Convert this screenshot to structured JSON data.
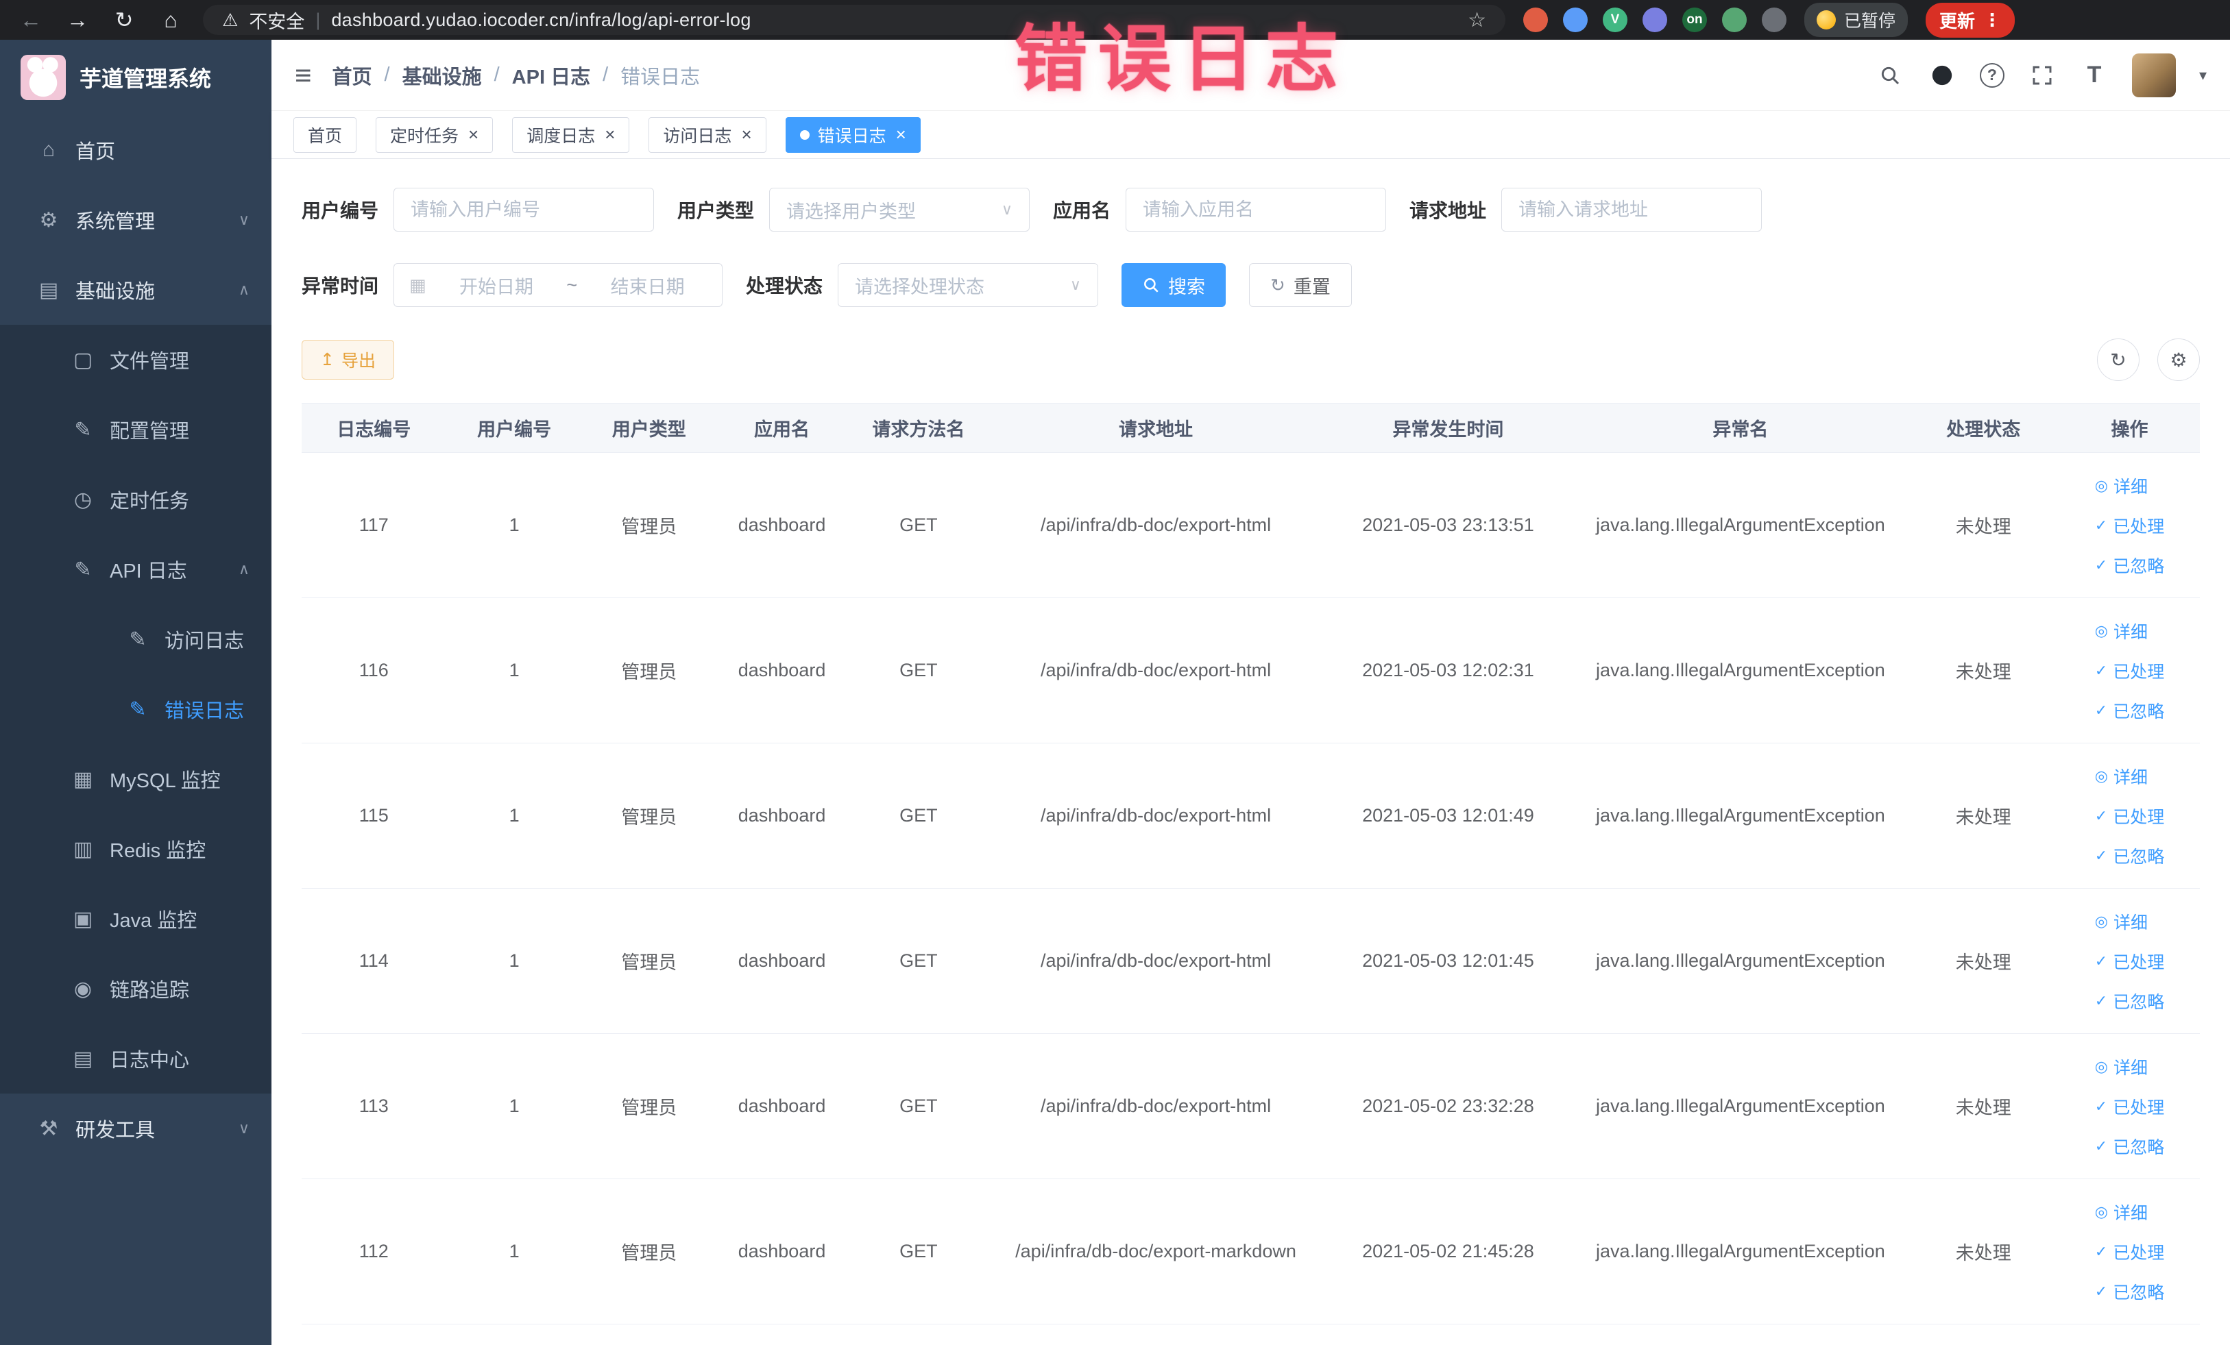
{
  "browser": {
    "security_label": "不安全",
    "url": "dashboard.yudao.iocoder.cn/infra/log/api-error-log",
    "paused_badge": "已暂停",
    "update_label": "更新",
    "extensions": [
      {
        "name": "extension-red-icon",
        "color": "#e05d44",
        "glyph": ""
      },
      {
        "name": "extension-blue-icon",
        "color": "#5b9cf8",
        "glyph": ""
      },
      {
        "name": "vue-devtools-icon",
        "color": "#42b883",
        "glyph": "V"
      },
      {
        "name": "extension-grid-icon",
        "color": "#7a7fe0",
        "glyph": ""
      },
      {
        "name": "extension-on-icon",
        "color": "#1e6b3c",
        "glyph": "on"
      },
      {
        "name": "extension-leaf-icon",
        "color": "#57a773",
        "glyph": ""
      },
      {
        "name": "extension-puzzle-icon",
        "color": "#6b6f76",
        "glyph": ""
      }
    ]
  },
  "annotation": {
    "text": "错误日志",
    "color": "#f2536f"
  },
  "sidebar": {
    "logo_title": "芋道管理系统",
    "menu": [
      {
        "label": "首页",
        "icon": "home-icon"
      },
      {
        "label": "系统管理",
        "icon": "gear-icon",
        "state": "collapsed"
      },
      {
        "label": "基础设施",
        "icon": "infra-icon",
        "state": "expanded",
        "children": [
          {
            "label": "文件管理",
            "icon": "file-icon"
          },
          {
            "label": "配置管理",
            "icon": "config-icon"
          },
          {
            "label": "定时任务",
            "icon": "timer-icon"
          },
          {
            "label": "API 日志",
            "icon": "api-log-icon",
            "state": "expanded",
            "children": [
              {
                "label": "访问日志",
                "icon": "access-log-icon"
              },
              {
                "label": "错误日志",
                "icon": "error-log-icon",
                "active": true
              }
            ]
          },
          {
            "label": "MySQL 监控",
            "icon": "mysql-icon"
          },
          {
            "label": "Redis 监控",
            "icon": "redis-icon"
          },
          {
            "label": "Java 监控",
            "icon": "java-icon"
          },
          {
            "label": "链路追踪",
            "icon": "trace-icon"
          },
          {
            "label": "日志中心",
            "icon": "log-center-icon"
          }
        ]
      },
      {
        "label": "研发工具",
        "icon": "tools-icon",
        "state": "collapsed"
      }
    ]
  },
  "header": {
    "breadcrumb": [
      "首页",
      "基础设施",
      "API 日志",
      "错误日志"
    ]
  },
  "tabs": [
    {
      "label": "首页",
      "closable": false,
      "active": false
    },
    {
      "label": "定时任务",
      "closable": true,
      "active": false
    },
    {
      "label": "调度日志",
      "closable": true,
      "active": false
    },
    {
      "label": "访问日志",
      "closable": true,
      "active": false
    },
    {
      "label": "错误日志",
      "closable": true,
      "active": true
    }
  ],
  "filter_rows": [
    [
      {
        "name": "user-id",
        "label": "用户编号",
        "type": "input",
        "placeholder": "请输入用户编号"
      },
      {
        "name": "user-type",
        "label": "用户类型",
        "type": "select",
        "placeholder": "请选择用户类型"
      },
      {
        "name": "app-name",
        "label": "应用名",
        "type": "input",
        "placeholder": "请输入应用名"
      },
      {
        "name": "request-url",
        "label": "请求地址",
        "type": "input",
        "placeholder": "请输入请求地址"
      }
    ],
    [
      {
        "name": "exception-time",
        "label": "异常时间",
        "type": "daterange",
        "start_placeholder": "开始日期",
        "separator": "~",
        "end_placeholder": "结束日期"
      },
      {
        "name": "process-status",
        "label": "处理状态",
        "type": "select",
        "placeholder": "请选择处理状态"
      }
    ]
  ],
  "filter_buttons": {
    "search": "搜索",
    "reset": "重置"
  },
  "toolbar": {
    "export_label": "导出"
  },
  "table": {
    "columns": [
      {
        "key": "id",
        "label": "日志编号"
      },
      {
        "key": "user_id",
        "label": "用户编号"
      },
      {
        "key": "user_type",
        "label": "用户类型"
      },
      {
        "key": "app",
        "label": "应用名"
      },
      {
        "key": "method",
        "label": "请求方法名"
      },
      {
        "key": "url",
        "label": "请求地址"
      },
      {
        "key": "time",
        "label": "异常发生时间"
      },
      {
        "key": "exception",
        "label": "异常名"
      },
      {
        "key": "status",
        "label": "处理状态"
      },
      {
        "key": "actions",
        "label": "操作"
      }
    ],
    "row_actions": [
      {
        "name": "detail-link",
        "label": "详细",
        "icon": "eye-icon"
      },
      {
        "name": "processed-link",
        "label": "已处理",
        "icon": "check-icon"
      },
      {
        "name": "ignored-link",
        "label": "已忽略",
        "icon": "check-icon"
      }
    ],
    "rows": [
      {
        "id": "117",
        "user_id": "1",
        "user_type": "管理员",
        "app": "dashboard",
        "method": "GET",
        "url": "/api/infra/db-doc/export-html",
        "time": "2021-05-03 23:13:51",
        "exception": "java.lang.IllegalArgumentException",
        "status": "未处理"
      },
      {
        "id": "116",
        "user_id": "1",
        "user_type": "管理员",
        "app": "dashboard",
        "method": "GET",
        "url": "/api/infra/db-doc/export-html",
        "time": "2021-05-03 12:02:31",
        "exception": "java.lang.IllegalArgumentException",
        "status": "未处理"
      },
      {
        "id": "115",
        "user_id": "1",
        "user_type": "管理员",
        "app": "dashboard",
        "method": "GET",
        "url": "/api/infra/db-doc/export-html",
        "time": "2021-05-03 12:01:49",
        "exception": "java.lang.IllegalArgumentException",
        "status": "未处理"
      },
      {
        "id": "114",
        "user_id": "1",
        "user_type": "管理员",
        "app": "dashboard",
        "method": "GET",
        "url": "/api/infra/db-doc/export-html",
        "time": "2021-05-03 12:01:45",
        "exception": "java.lang.IllegalArgumentException",
        "status": "未处理"
      },
      {
        "id": "113",
        "user_id": "1",
        "user_type": "管理员",
        "app": "dashboard",
        "method": "GET",
        "url": "/api/infra/db-doc/export-html",
        "time": "2021-05-02 23:32:28",
        "exception": "java.lang.IllegalArgumentException",
        "status": "未处理"
      },
      {
        "id": "112",
        "user_id": "1",
        "user_type": "管理员",
        "app": "dashboard",
        "method": "GET",
        "url": "/api/infra/db-doc/export-markdown",
        "time": "2021-05-02 21:45:28",
        "exception": "java.lang.IllegalArgumentException",
        "status": "未处理"
      }
    ]
  },
  "icons": {
    "home-icon": "⌂",
    "gear-icon": "⚙",
    "infra-icon": "▤",
    "file-icon": "▢",
    "config-icon": "✎",
    "timer-icon": "◷",
    "api-log-icon": "✎",
    "access-log-icon": "✎",
    "error-log-icon": "✎",
    "mysql-icon": "▦",
    "redis-icon": "▥",
    "java-icon": "▣",
    "trace-icon": "◉",
    "log-center-icon": "▤",
    "tools-icon": "⚒",
    "chevron-down-icon": "∨",
    "chevron-up-icon": "∧",
    "calendar-icon": "▦",
    "refresh-icon": "↻",
    "settings-icon": "⚙",
    "export-icon": "↥",
    "eye-icon": "◎",
    "check-icon": "✓",
    "close-icon": "×",
    "star-icon": "☆",
    "warning-icon": "⚠",
    "back-icon": "←",
    "forward-icon": "→",
    "reload-icon": "↻",
    "home-nav-icon": "⌂",
    "menu-dots-icon": "⋮",
    "hamburger-icon": "≡",
    "caret-down-icon": "▾",
    "question-icon": "?",
    "fontsize-icon": "T"
  }
}
